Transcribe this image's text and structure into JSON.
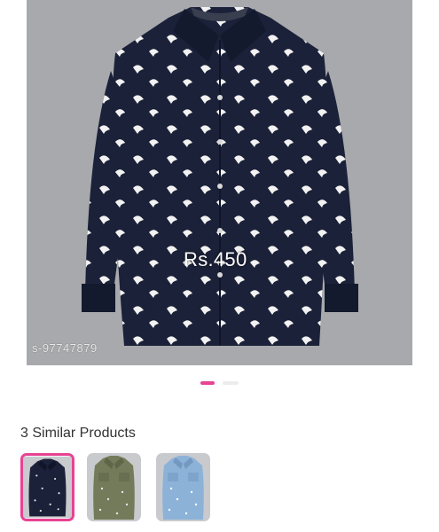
{
  "product": {
    "price_overlay": "Rs.450",
    "watermark": "s-97747879"
  },
  "carousel": {
    "active_index": 0,
    "dot_count": 2
  },
  "similar": {
    "title": "3 Similar Products",
    "items": [
      {
        "name": "navy printed shirt",
        "color": "#1b2138",
        "selected": true
      },
      {
        "name": "olive printed shirt",
        "color": "#737b5a",
        "selected": false
      },
      {
        "name": "light blue printed shirt",
        "color": "#8db2d8",
        "selected": false
      }
    ]
  },
  "colors": {
    "accent": "#e84393",
    "hero_bg": "#a8a9ad",
    "shirt": "#1b2138"
  }
}
